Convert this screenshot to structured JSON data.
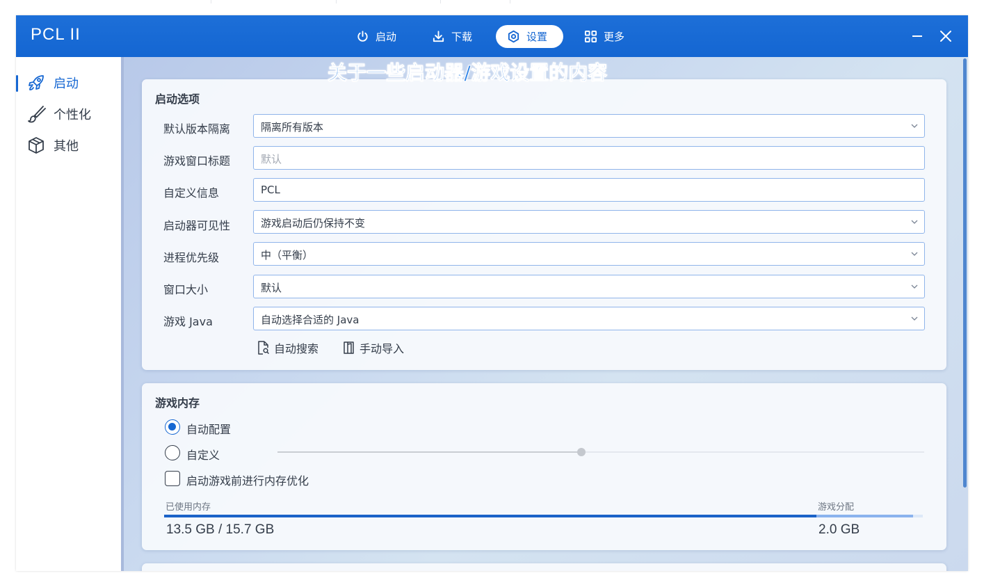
{
  "app": {
    "title": "PCL II"
  },
  "nav": {
    "tabs": [
      {
        "label": "启动",
        "icon": "power-icon"
      },
      {
        "label": "下载",
        "icon": "download-icon"
      },
      {
        "label": "设置",
        "icon": "settings-icon",
        "active": true
      },
      {
        "label": "更多",
        "icon": "grid-icon"
      }
    ]
  },
  "window_controls": {
    "minimize": "minimize-icon",
    "close": "close-icon"
  },
  "sidebar": {
    "items": [
      {
        "label": "启动",
        "icon": "rocket-icon",
        "active": true
      },
      {
        "label": "个性化",
        "icon": "brush-icon"
      },
      {
        "label": "其他",
        "icon": "box-icon"
      }
    ]
  },
  "overlay_caption": "关于一些启动器/游戏设置的内容",
  "launch_options": {
    "title": "启动选项",
    "rows": [
      {
        "label": "默认版本隔离",
        "value": "隔离所有版本",
        "type": "select"
      },
      {
        "label": "游戏窗口标题",
        "value": "",
        "placeholder": "默认",
        "type": "text"
      },
      {
        "label": "自定义信息",
        "value": "PCL",
        "type": "text"
      },
      {
        "label": "启动器可见性",
        "value": "游戏启动后仍保持不变",
        "type": "select"
      },
      {
        "label": "进程优先级",
        "value": "中（平衡）",
        "type": "select"
      },
      {
        "label": "窗口大小",
        "value": "默认",
        "type": "select"
      },
      {
        "label": "游戏 Java",
        "value": "自动选择合适的 Java",
        "type": "select"
      }
    ],
    "auto_search_label": "自动搜索",
    "manual_import_label": "手动导入"
  },
  "memory": {
    "title": "游戏内存",
    "auto_label": "自动配置",
    "custom_label": "自定义",
    "optimize_label": "启动游戏前进行内存优化",
    "selected": "auto",
    "optimize_checked": false,
    "slider_fraction": 0.47,
    "used_label": "已使用内存",
    "alloc_label": "游戏分配",
    "used_value": "13.5 GB / 15.7 GB",
    "alloc_value": "2.0 GB",
    "used_fraction": 0.86,
    "alloc_fraction": 0.127
  },
  "colors": {
    "accent": "#1667d2",
    "titlebar": "#1466d2"
  }
}
